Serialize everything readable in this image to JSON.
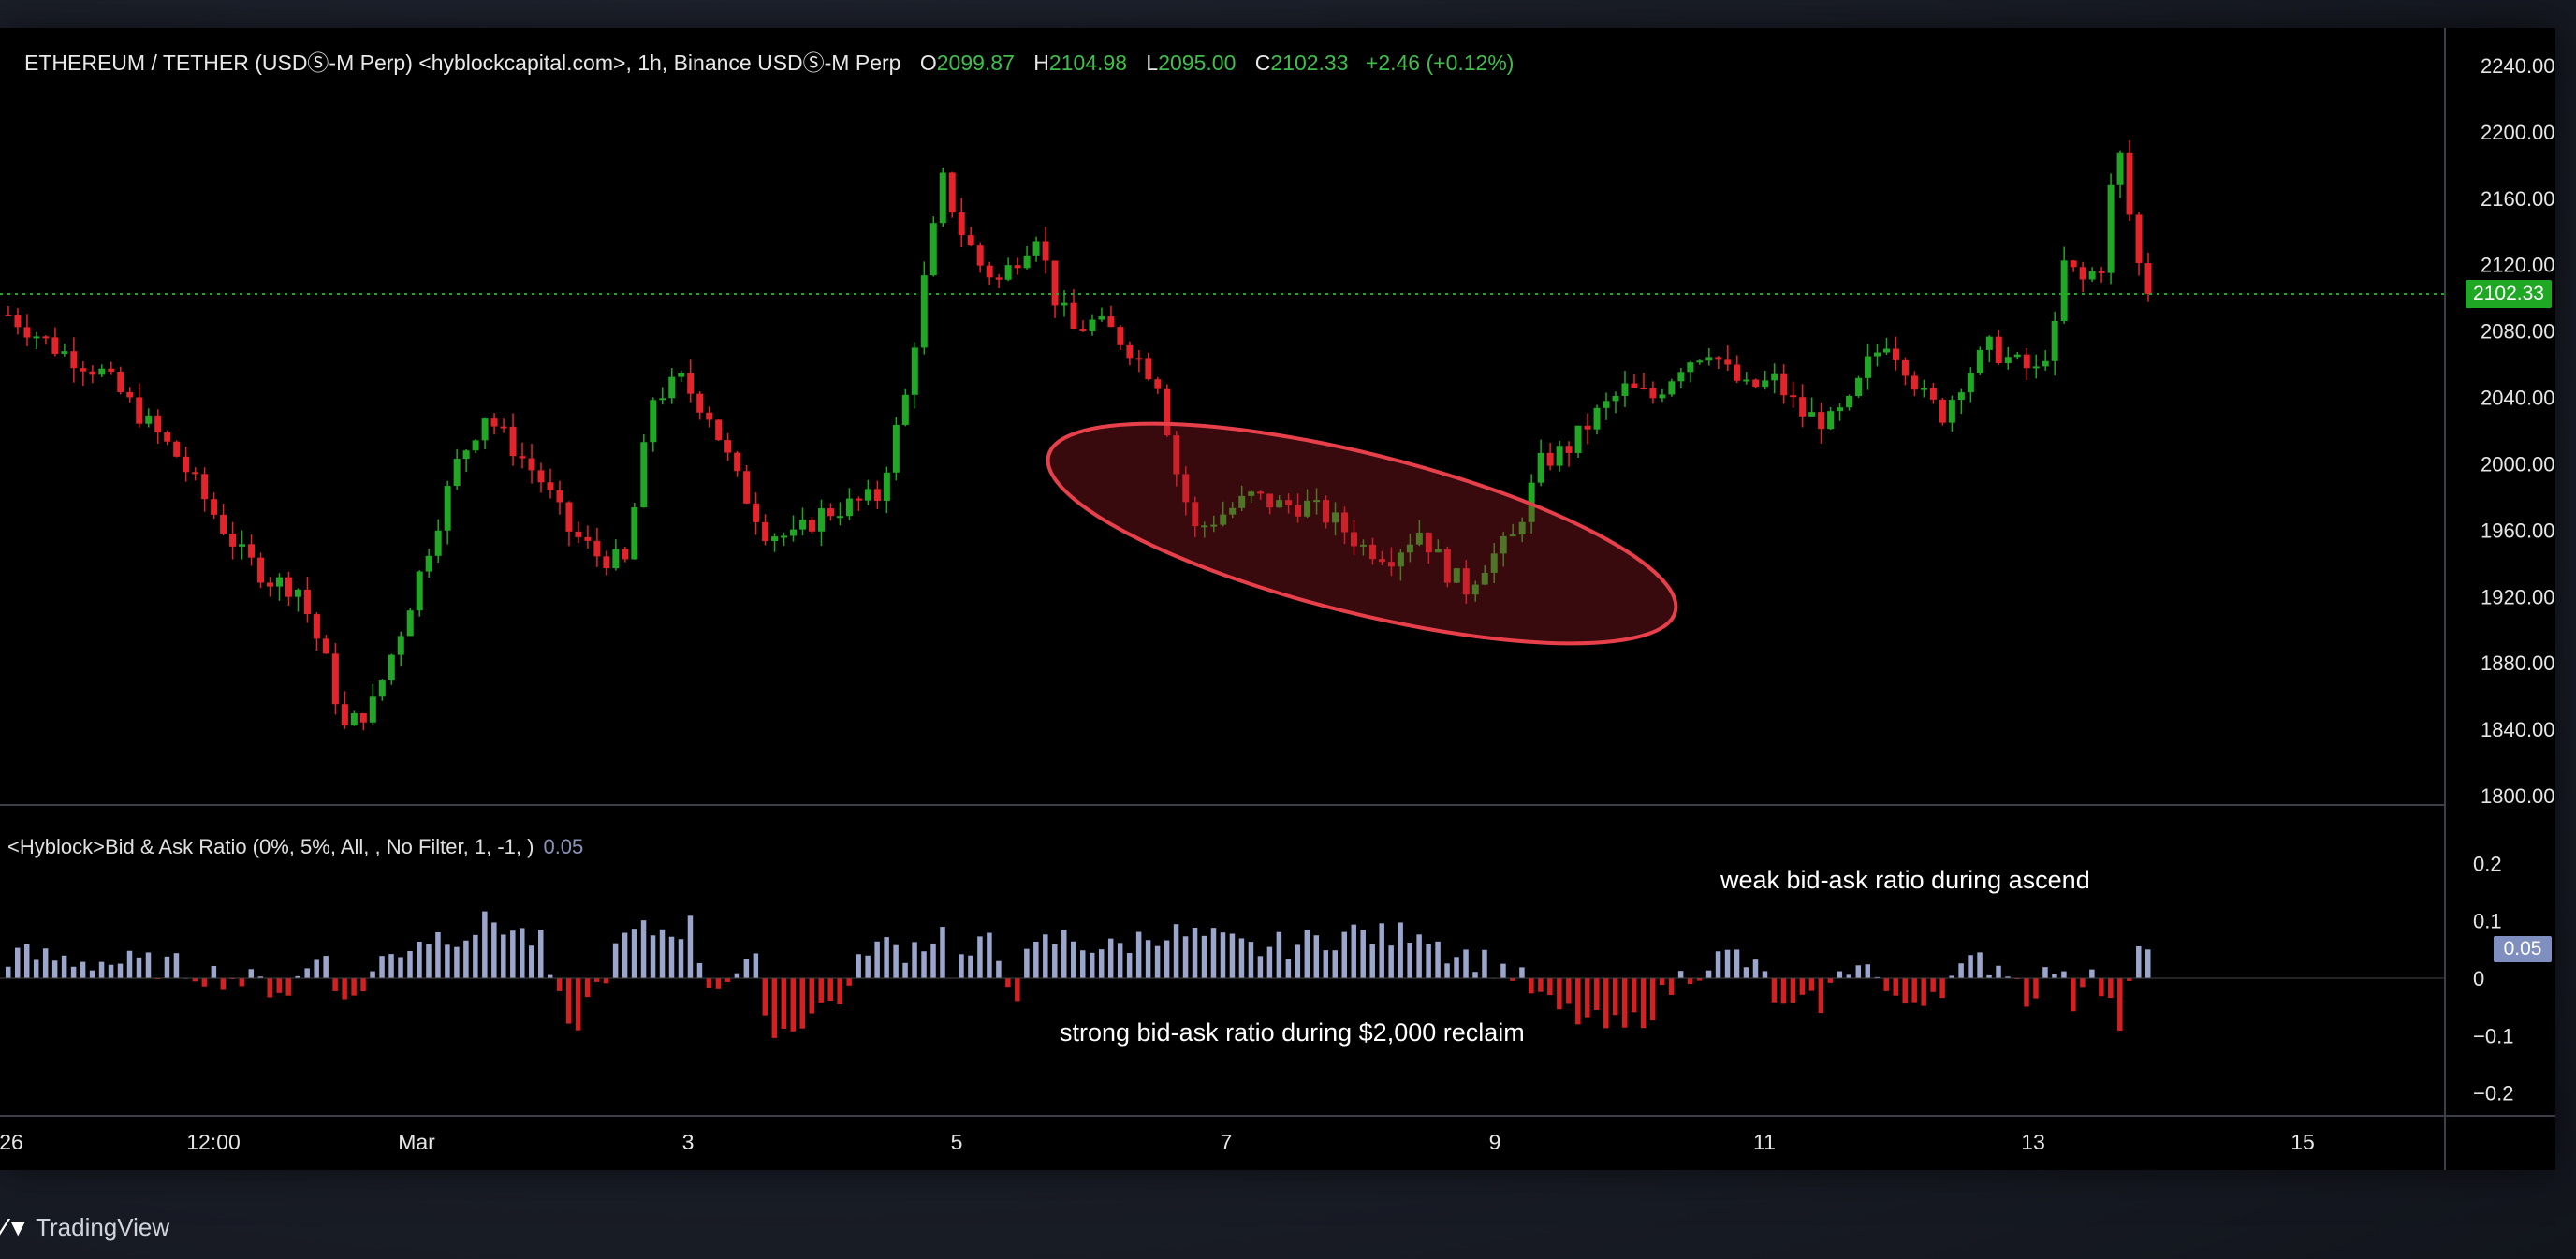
{
  "header": {
    "symbol": "ETHEREUM / TETHER (USDⓈ-M Perp) <hyblockcapital.com>, 1h, Binance USDⓈ-M Perp",
    "open_label": "O",
    "open": "2099.87",
    "high_label": "H",
    "high": "2104.98",
    "low_label": "L",
    "low": "2095.00",
    "close_label": "C",
    "close": "2102.33",
    "change": "+2.46 (+0.12%)"
  },
  "indicator": {
    "title": "<Hyblock>Bid & Ask Ratio (0%, 5%, All, , No Filter, 1, -1, )",
    "value": "0.05",
    "value_tag": "0.05"
  },
  "annotations": {
    "weak": "weak bid-ask ratio during ascend",
    "strong": "strong bid-ask ratio during $2,000 reclaim"
  },
  "brand": {
    "logo": "⁄▼",
    "name": "TradingView"
  },
  "colors": {
    "up": "#22a626",
    "down": "#e3242b",
    "bid_positive": "#9aa6cc",
    "bid_negative": "#d42020",
    "price_line": "#22a626",
    "highlight": "#e8404a"
  },
  "chart_data": [
    {
      "type": "candlestick",
      "title": "ETHEREUM / TETHER (USDⓈ-M Perp) <hyblockcapital.com>, 1h, Binance USDⓈ-M Perp",
      "x_ticks": [
        "26",
        "12:00",
        "Mar",
        "3",
        "5",
        "7",
        "9",
        "11",
        "13",
        "15"
      ],
      "y_ticks": [
        "2240.00",
        "2200.00",
        "2160.00",
        "2120.00",
        "2080.00",
        "2040.00",
        "2000.00",
        "1960.00",
        "1920.00",
        "1880.00",
        "1840.00",
        "1800.00"
      ],
      "ylim": [
        1800,
        2240
      ],
      "last_price": 2102.33,
      "last_price_label": "2102.33",
      "grid": false,
      "close_path": [
        [
          0,
          2090
        ],
        [
          5,
          2070
        ],
        [
          10,
          2055
        ],
        [
          14,
          2030
        ],
        [
          18,
          2005
        ],
        [
          22,
          1970
        ],
        [
          25,
          1945
        ],
        [
          28,
          1930
        ],
        [
          31,
          1925
        ],
        [
          34,
          1880
        ],
        [
          36,
          1840
        ],
        [
          39,
          1855
        ],
        [
          42,
          1900
        ],
        [
          45,
          1950
        ],
        [
          48,
          2000
        ],
        [
          51,
          2030
        ],
        [
          54,
          2010
        ],
        [
          57,
          1990
        ],
        [
          60,
          1960
        ],
        [
          63,
          1945
        ],
        [
          66,
          1940
        ],
        [
          69,
          2040
        ],
        [
          72,
          2050
        ],
        [
          75,
          2030
        ],
        [
          78,
          1990
        ],
        [
          81,
          1960
        ],
        [
          84,
          1955
        ],
        [
          87,
          1970
        ],
        [
          90,
          1975
        ],
        [
          93,
          1980
        ],
        [
          96,
          2040
        ],
        [
          98,
          2110
        ],
        [
          100,
          2170
        ],
        [
          102,
          2140
        ],
        [
          104,
          2120
        ],
        [
          106,
          2110
        ],
        [
          108,
          2125
        ],
        [
          110,
          2140
        ],
        [
          112,
          2100
        ],
        [
          114,
          2080
        ],
        [
          116,
          2085
        ],
        [
          118,
          2080
        ],
        [
          120,
          2070
        ],
        [
          123,
          2050
        ],
        [
          125,
          1995
        ],
        [
          127,
          1960
        ],
        [
          130,
          1970
        ],
        [
          133,
          1980
        ],
        [
          136,
          1975
        ],
        [
          139,
          1975
        ],
        [
          142,
          1965
        ],
        [
          145,
          1950
        ],
        [
          148,
          1945
        ],
        [
          151,
          1960
        ],
        [
          154,
          1935
        ],
        [
          156,
          1925
        ],
        [
          158,
          1940
        ],
        [
          161,
          1955
        ],
        [
          164,
          2000
        ],
        [
          167,
          2010
        ],
        [
          170,
          2030
        ],
        [
          173,
          2045
        ],
        [
          176,
          2040
        ],
        [
          179,
          2060
        ],
        [
          182,
          2070
        ],
        [
          184,
          2055
        ],
        [
          186,
          2045
        ],
        [
          189,
          2050
        ],
        [
          192,
          2030
        ],
        [
          195,
          2025
        ],
        [
          197,
          2035
        ],
        [
          199,
          2060
        ],
        [
          201,
          2075
        ],
        [
          203,
          2060
        ],
        [
          205,
          2040
        ],
        [
          207,
          2030
        ],
        [
          209,
          2050
        ],
        [
          212,
          2070
        ],
        [
          215,
          2060
        ],
        [
          217,
          2055
        ],
        [
          219,
          2080
        ],
        [
          220,
          2120
        ],
        [
          222,
          2110
        ],
        [
          224,
          2120
        ],
        [
          225,
          2165
        ],
        [
          226,
          2185
        ],
        [
          227,
          2150
        ],
        [
          228,
          2120
        ],
        [
          229,
          2102.33
        ]
      ]
    },
    {
      "type": "bar",
      "title": "<Hyblock>Bid & Ask Ratio (0%, 5%, All, , No Filter, 1, -1, )",
      "y_ticks": [
        "0.2",
        "0.1",
        "0",
        "−0.1",
        "−0.2"
      ],
      "ylim": [
        -0.22,
        0.22
      ],
      "last_value": 0.05,
      "segments": [
        [
          0,
          0.04
        ],
        [
          18,
          0.02
        ],
        [
          30,
          -0.02
        ],
        [
          34,
          0.05
        ],
        [
          36,
          -0.05
        ],
        [
          40,
          0.03
        ],
        [
          44,
          0.07
        ],
        [
          49,
          0.08
        ],
        [
          52,
          0.1
        ],
        [
          57,
          0.06
        ],
        [
          60,
          -0.1
        ],
        [
          66,
          0.07
        ],
        [
          68,
          0.08
        ],
        [
          73,
          0.09
        ],
        [
          75,
          -0.01
        ],
        [
          80,
          0.02
        ],
        [
          82,
          -0.1
        ],
        [
          90,
          -0.02
        ],
        [
          92,
          0.06
        ],
        [
          96,
          0.05
        ],
        [
          100,
          0.08
        ],
        [
          101,
          0.02
        ],
        [
          105,
          0.06
        ],
        [
          108,
          -0.02
        ],
        [
          109,
          0.03
        ],
        [
          111,
          0.06
        ],
        [
          113,
          0.07
        ],
        [
          118,
          0.05
        ],
        [
          123,
          0.08
        ],
        [
          128,
          0.07
        ],
        [
          133,
          0.05
        ],
        [
          138,
          0.06
        ],
        [
          144,
          0.08
        ],
        [
          148,
          0.07
        ],
        [
          151,
          0.09
        ],
        [
          154,
          0.05
        ],
        [
          158,
          0.03
        ],
        [
          161,
          0.01
        ],
        [
          165,
          -0.05
        ],
        [
          170,
          -0.08
        ],
        [
          173,
          -0.09
        ],
        [
          176,
          -0.05
        ],
        [
          179,
          0.0
        ],
        [
          182,
          0.03
        ],
        [
          185,
          0.04
        ],
        [
          188,
          0.0
        ],
        [
          190,
          -0.06
        ],
        [
          194,
          -0.04
        ],
        [
          198,
          0.04
        ],
        [
          200,
          0.0
        ],
        [
          202,
          -0.05
        ],
        [
          206,
          -0.02
        ],
        [
          208,
          0.0
        ],
        [
          211,
          0.03
        ],
        [
          214,
          0.02
        ],
        [
          216,
          -0.03
        ],
        [
          219,
          0.02
        ],
        [
          221,
          -0.04
        ],
        [
          223,
          0.03
        ],
        [
          226,
          -0.08
        ],
        [
          228,
          0.04
        ],
        [
          229,
          0.05
        ]
      ]
    }
  ]
}
